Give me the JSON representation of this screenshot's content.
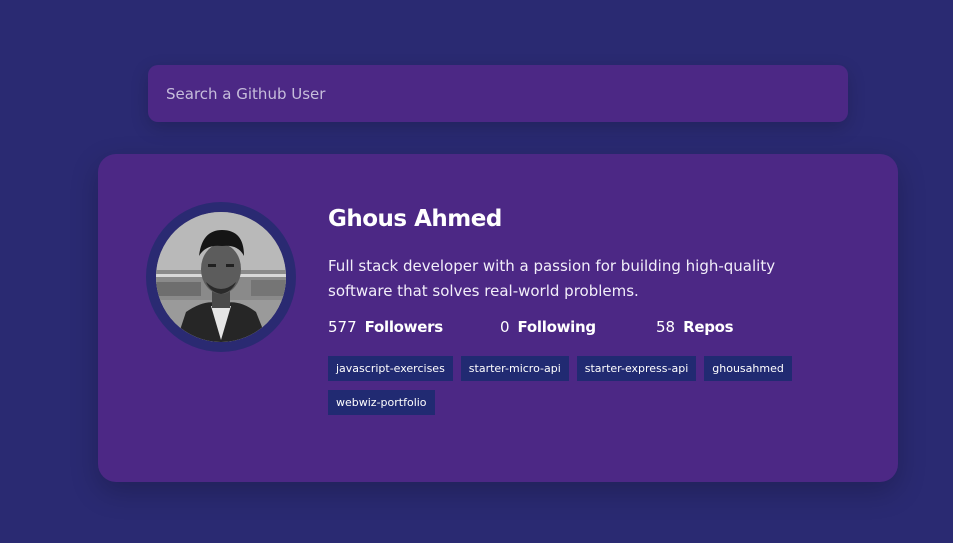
{
  "search": {
    "placeholder": "Search a Github User"
  },
  "profile": {
    "name": "Ghous Ahmed",
    "bio": "Full stack developer with a passion for building high-quality software that solves real-world problems.",
    "stats": [
      {
        "value": "577",
        "label": "Followers"
      },
      {
        "value": "0",
        "label": "Following"
      },
      {
        "value": "58",
        "label": "Repos"
      }
    ],
    "repos": [
      "javascript-exercises",
      "starter-micro-api",
      "starter-express-api",
      "ghousahmed",
      "webwiz-portfolio"
    ]
  },
  "colors": {
    "background": "#2a2a72",
    "card": "#4c2885",
    "repo_tag": "#212a72",
    "text": "#ffffff"
  }
}
